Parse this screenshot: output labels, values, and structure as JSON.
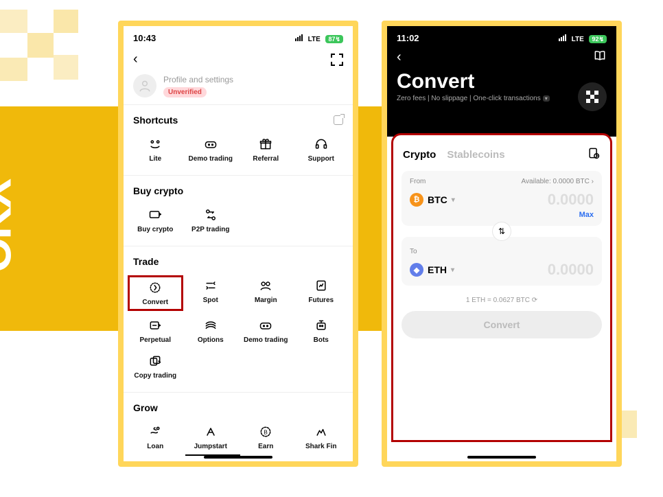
{
  "brand": "OKX",
  "phoneA": {
    "time": "10:43",
    "network": "LTE",
    "battery": "87",
    "profile_label": "Profile and settings",
    "unverified": "Unverified",
    "shortcuts_title": "Shortcuts",
    "shortcuts": {
      "lite": "Lite",
      "demo": "Demo trading",
      "referral": "Referral",
      "support": "Support"
    },
    "buy_crypto_title": "Buy crypto",
    "buy": {
      "buy": "Buy crypto",
      "p2p": "P2P trading"
    },
    "trade_title": "Trade",
    "trade": {
      "convert": "Convert",
      "spot": "Spot",
      "margin": "Margin",
      "futures": "Futures",
      "perpetual": "Perpetual",
      "options": "Options",
      "demo": "Demo trading",
      "bots": "Bots",
      "copy": "Copy trading"
    },
    "grow_title": "Grow",
    "grow": {
      "loan": "Loan",
      "jumpstart": "Jumpstart",
      "earn": "Earn",
      "shark": "Shark Fin"
    }
  },
  "phoneB": {
    "time": "11:02",
    "network": "LTE",
    "battery": "92",
    "title": "Convert",
    "subtitle": "Zero fees | No slippage | One-click transactions",
    "tab_crypto": "Crypto",
    "tab_stable": "Stablecoins",
    "from_label": "From",
    "available_label": "Available: 0.0000 BTC",
    "from_coin": "BTC",
    "from_amount": "0.0000",
    "max": "Max",
    "to_label": "To",
    "to_coin": "ETH",
    "to_amount": "0.0000",
    "rate": "1 ETH = 0.0627 BTC",
    "button": "Convert"
  }
}
